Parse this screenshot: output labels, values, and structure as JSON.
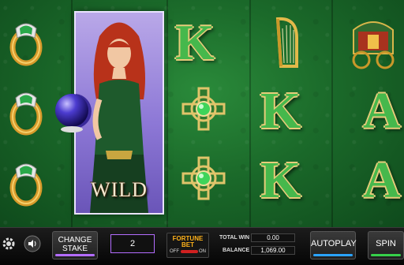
{
  "reels": {
    "wild_label": "WILD",
    "letters": [
      "K",
      "K",
      "A",
      "K",
      "A"
    ]
  },
  "controls": {
    "change_stake_line1": "CHANGE",
    "change_stake_line2": "STAKE",
    "stake_value": "2",
    "fortune_bet_line1": "FORTUNE",
    "fortune_bet_line2": "BET",
    "fortune_off": "OFF",
    "fortune_on": "ON",
    "total_win_label": "TOTAL WIN",
    "total_win_value": "0.00",
    "balance_label": "BALANCE",
    "balance_value": "1,069.00",
    "autoplay_label": "AUTOPLAY",
    "spin_label": "SPIN"
  },
  "colors": {
    "change_stake_underline": "#b36cff",
    "autoplay_underline": "#2aa3ff",
    "spin_underline": "#36d14a"
  },
  "icons": [
    "gear-icon",
    "speaker-icon"
  ]
}
